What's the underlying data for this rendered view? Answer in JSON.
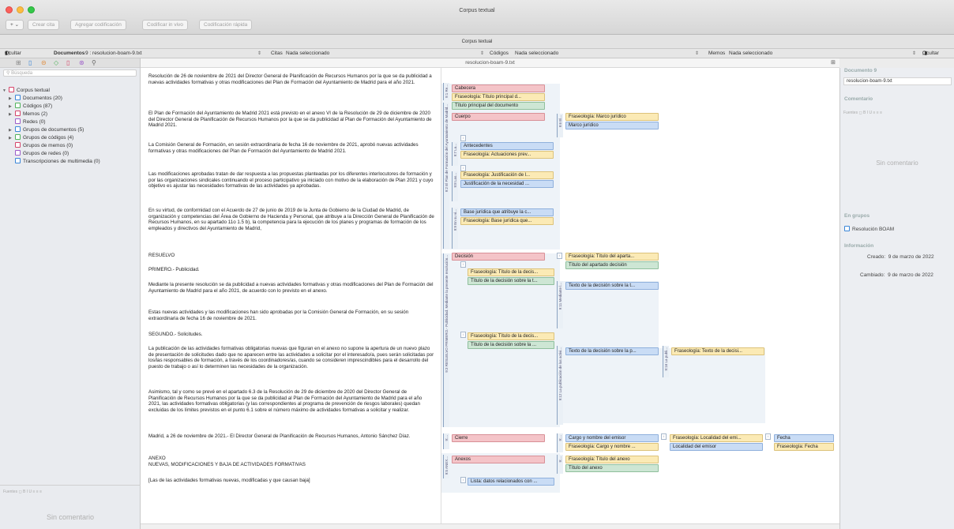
{
  "window": {
    "title": "Corpus textual",
    "subtitle": "Corpus textual"
  },
  "toolbar": {
    "add": "+ ⌄",
    "buttons": [
      "Crear cita",
      "Agregar codificación",
      "Codificar in vivo",
      "Codificación rápida"
    ]
  },
  "headbar": {
    "hide_left": "Ocultar",
    "documents": "Documentos",
    "doc_value": "9 : resolucion-boam-9.txt",
    "citas": "Citas",
    "citas_val": "Nada seleccionado",
    "codigos": "Códigos",
    "codigos_val": "Nada seleccionado",
    "memos": "Memos",
    "memos_val": "Nada seleccionado",
    "hide_right": "Ocultar"
  },
  "sidebar": {
    "search_placeholder": "Búsqueda",
    "root": "Corpus textual",
    "items": [
      {
        "label": "Documentos (20)",
        "arrow": "▶",
        "color": "#3a86d8"
      },
      {
        "label": "Códigos (87)",
        "arrow": "▶",
        "color": "#4fb35b"
      },
      {
        "label": "Memos (2)",
        "arrow": "▶",
        "color": "#d6456a"
      },
      {
        "label": "Redes (0)",
        "arrow": "",
        "color": "#9c5cc9"
      },
      {
        "label": "Grupos de documentos (5)",
        "arrow": "▶",
        "color": "#3a86d8"
      },
      {
        "label": "Grupos de códigos (4)",
        "arrow": "▶",
        "color": "#4fb35b"
      },
      {
        "label": "Grupos de memos (0)",
        "arrow": "",
        "color": "#d6456a"
      },
      {
        "label": "Grupos de redes (0)",
        "arrow": "",
        "color": "#9c5cc9"
      },
      {
        "label": "Transcripciones de multimedia (0)",
        "arrow": "",
        "color": "#3a86d8"
      }
    ],
    "format_bar": "Fuentes  ◻  B  I  U  ≡  ≡  ≡",
    "no_comment": "Sin comentario"
  },
  "document": {
    "title": "resolucion-boam-9.txt",
    "paragraphs": [
      "Resolución de 26 de noviembre de 2021 del Director General de Planificación de Recursos Humanos por la que se da publicidad a nuevas actividades formativas y otras modificaciones del Plan de Formación del Ayuntamiento de Madrid para el año 2021.",
      "El Plan de Formación del Ayuntamiento de Madrid 2021 está previsto en el anexo VI de la Resolución de 29 de diciembre de 2020 del Director General de Planificación de Recursos Humanos por la que se da publicidad al Plan de Formación del Ayuntamiento de Madrid 2021.",
      "La Comisión General de Formación, en sesión extraordinaria de fecha 16 de noviembre de 2021, aprobó nuevas actividades formativas y otras modificaciones del Plan de Formación del Ayuntamiento de Madrid 2021.",
      "Las modificaciones aprobadas tratan de dar respuesta a las propuestas planteadas por los diferentes interlocutores de formación y por las organizaciones sindicales continuando el proceso participativo ya iniciado con motivo de la elaboración de Plan 2021 y cuyo objetivo es ajustar las necesidades formativas de las actividades ya aprobadas.",
      "En su virtud, de conformidad con el Acuerdo de 27 de junio de 2019 de la Junta de Gobierno de la Ciudad de Madrid, de organización y competencias del Área de Gobierno de Hacienda y Personal, que atribuye a la Dirección General de Planificación de Recursos Humanos, en su apartado 11o 1.5 b), la competencia para la ejecución de los planes y programas de formación de los empleados y directivos del Ayuntamiento de Madrid,",
      "RESUELVO",
      "PRIMERO.- Publicidad.",
      "Mediante la presente resolución se da publicidad a nuevas actividades formativas y otras modificaciones del Plan de Formación del Ayuntamiento de Madrid para el año 2021, de acuerdo con lo previsto en el anexo.",
      "Estas nuevas actividades y las modificaciones han sido aprobadas por la Comisión General de Formación, en su sesión extraordinaria de fecha 16 de noviembre de 2021.",
      "SEGUNDO.- Solicitudes.",
      "La publicación de las actividades formativas obligatorias nuevas que figuran en el anexo no supone la apertura de un nuevo plazo de presentación de solicitudes dado que no aparecen entre las actividades a solicitar por el interesado/a, pues serán solicitadas por los/las responsables de formación, a través de los coordinadores/as, cuando se consideren imprescindibles para el desarrollo del puesto de trabajo o así lo determinen las necesidades de la organización.",
      "Asimismo, tal y como se prevé en el apartado 6.3 de la Resolución de 29 de diciembre de 2020 del Director General de Planificación de Recursos Humanos por la que se da publicidad al Plan de Formación del Ayuntamiento de Madrid para el año 2021, las actividades formativas obligatorias (y las correspondientes al programa de prevención de riesgos laborales) quedan excluidas de los límites previstos en el punto 6.1 sobre el número máximo de actividades formativas a solicitar y realizar.",
      "Madrid, a 26 de noviembre de 2021.- El Director General de Planificación de Recursos Humanos, Antonio Sánchez Díaz.",
      "ANEXO\nNUEVAS, MODIFICACIONES Y BAJA DE ACTIVIDADES FORMATIVAS",
      "[Las de las actividades formativas nuevas, modificadas y que causan baja]"
    ]
  },
  "margin": {
    "brackets": [
      "9:1 Re...",
      "9:2 El Plan de Formación del Ayuntamiento de Madrid...",
      "9:7 La...",
      "9:8 Las...",
      "9:9 En su vi...",
      "9:3 RESUELVO PRIMERO.- Publicidad. Mediante la presente resolución...",
      "9:11 Mediante l...",
      "9:12 La publicación de las activi...",
      "9:16 La publi...",
      "9:6 El...",
      "9:...",
      "9:...",
      "9:5 ANEX..."
    ],
    "codes": [
      "Cabecera",
      "Fraseología: Título principal d...",
      "Título principal del documento",
      "Cuerpo",
      "Fraseología: Marco jurídico",
      "Marco jurídico",
      "Antecedentes",
      "Fraseología: Actuaciones prev...",
      "Fraseología: Justificación de l...",
      "Justificación de la necesidad ...",
      "Base jurídica que atribuye la c...",
      "Fraseología: Base jurídica que...",
      "Decisión",
      "Fraseología: Título del aparta...",
      "Título del apartado decisión",
      "Fraseología: Título de la decis...",
      "Título de la decisión sobre la t...",
      "Texto de la decisión sobre la t...",
      "Fraseología: Título de la decis...",
      "Título de la decisión sobre la ...",
      "Texto de la decisión sobre la p...",
      "Fraseología: Texto de la decisi...",
      "Cierre",
      "Cargo y nombre del emisor",
      "Fraseología: Localidad del emi...",
      "Fecha",
      "Fraseología: Cargo y nombre ...",
      "Localidad del emisor",
      "Fraseología: Fecha",
      "Anexos",
      "Fraseología: Título del anexo",
      "Título del anexo",
      "Lista: datos relacionados con ..."
    ]
  },
  "inspector": {
    "doc_header": "Documento 9",
    "doc_name": "resolucion-boam-9.txt",
    "comment_header": "Comentario",
    "format_bar": "Fuentes  ◻  B  I  U  ≡  ≡  ≡",
    "no_comment": "Sin comentario",
    "groups_header": "En grupos",
    "group": "Resolución BOAM",
    "info_header": "Información",
    "created_label": "Creado:",
    "created": "9 de marzo de 2022",
    "changed_label": "Cambiado:",
    "changed": "9 de marzo de 2022"
  }
}
